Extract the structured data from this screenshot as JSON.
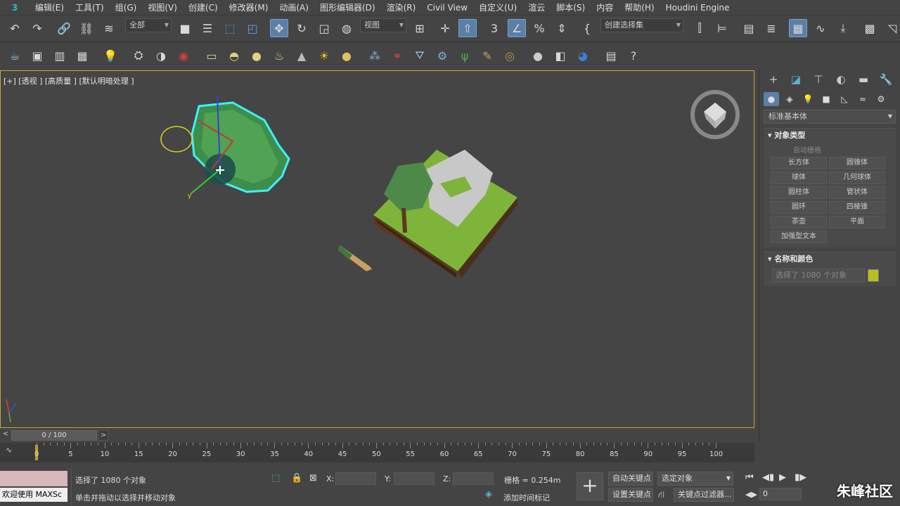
{
  "menu": {
    "logo": "3",
    "items": [
      "编辑(E)",
      "工具(T)",
      "组(G)",
      "视图(V)",
      "创建(C)",
      "修改器(M)",
      "动画(A)",
      "图形编辑器(D)",
      "渲染(R)",
      "Civil View",
      "自定义(U)",
      "渲云",
      "脚本(S)",
      "内容",
      "帮助(H)",
      "Houdini Engine"
    ]
  },
  "toolbar": {
    "filter_select": "全部",
    "ref_coord": "视图",
    "named_selection": "创建选择集"
  },
  "viewport": {
    "label": "[+] [透视 ] [高质量 ] [默认明暗处理 ]"
  },
  "command_panel": {
    "category": "标准基本体",
    "object_type_title": "对象类型",
    "autogrid": "自动栅格",
    "buttons": [
      "长方体",
      "圆锥体",
      "球体",
      "几何球体",
      "圆柱体",
      "管状体",
      "圆环",
      "四棱锥",
      "茶壶",
      "平面",
      "加强型文本"
    ],
    "name_color_title": "名称和颜色",
    "name_field": "选择了 1080 个对象",
    "object_color": "#b8bf20"
  },
  "timeline": {
    "slider": "0 / 100",
    "prev": "<",
    "next": ">",
    "ticks": [
      "0",
      "5",
      "10",
      "15",
      "20",
      "25",
      "30",
      "35",
      "40",
      "45",
      "50",
      "55",
      "60",
      "65",
      "70",
      "75",
      "80",
      "85",
      "90",
      "95",
      "100"
    ]
  },
  "status": {
    "welcome": "欢迎使用 MAXSc",
    "selected": "选择了 1080 个对象",
    "prompt": "单击并拖动以选择并移动对象",
    "x_label": "X:",
    "y_label": "Y:",
    "z_label": "Z:",
    "grid": "栅格 = 0.254m",
    "add_time_tag": "添加时间标记",
    "auto_key": "自动关键点",
    "set_key": "设置关键点",
    "selected_obj": "选定对象",
    "key_filters": "关键点过滤器...",
    "frame": "0"
  },
  "watermark": "朱峰社区"
}
